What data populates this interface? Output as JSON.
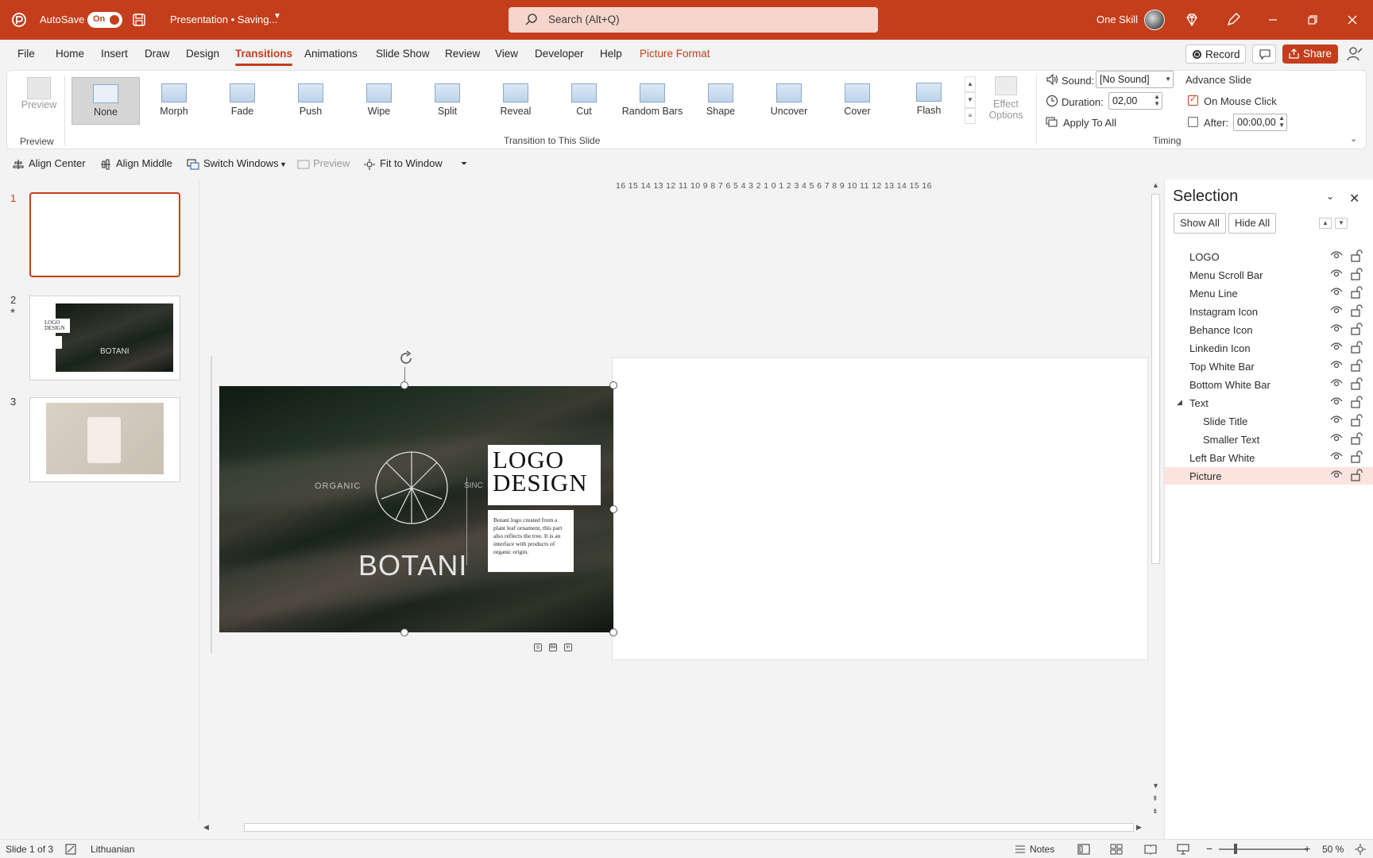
{
  "titlebar": {
    "autosave_label": "AutoSave",
    "autosave_state": "On",
    "doc_title": "Presentation • Saving...",
    "search_placeholder": "Search (Alt+Q)",
    "user_name": "One Skill",
    "accent_color": "#c43e1c"
  },
  "menu": {
    "tabs": [
      "File",
      "Home",
      "Insert",
      "Draw",
      "Design",
      "Transitions",
      "Animations",
      "Slide Show",
      "Review",
      "View",
      "Developer",
      "Help",
      "Picture Format"
    ],
    "active_tab": "Transitions",
    "record_label": "Record",
    "share_label": "Share"
  },
  "ribbon": {
    "preview_label": "Preview",
    "preview_group": "Preview",
    "transitions": [
      "None",
      "Morph",
      "Fade",
      "Push",
      "Wipe",
      "Split",
      "Reveal",
      "Cut",
      "Random Bars",
      "Shape",
      "Uncover",
      "Cover",
      "Flash"
    ],
    "selected_transition": "None",
    "effect_options_line1": "Effect",
    "effect_options_line2": "Options",
    "transition_group": "Transition to This Slide",
    "sound_label": "Sound:",
    "sound_value": "[No Sound]",
    "duration_label": "Duration:",
    "duration_value": "02,00",
    "apply_all_label": "Apply To All",
    "advance_title": "Advance Slide",
    "on_mouse_click_label": "On Mouse Click",
    "on_mouse_click_checked": true,
    "after_label": "After:",
    "after_checked": false,
    "after_value": "00:00,00",
    "timing_group": "Timing"
  },
  "qat": {
    "align_center": "Align Center",
    "align_middle": "Align Middle",
    "switch_windows": "Switch Windows",
    "preview": "Preview",
    "fit_to_window": "Fit to Window"
  },
  "slides": {
    "numbers": [
      "1",
      "2",
      "3"
    ],
    "active": "1",
    "thumb2_logo": "LOGO DESIGN",
    "thumb2_brand": "BOTANI"
  },
  "canvas": {
    "ruler_h": "16 15 14 13 12 11 10 9 8 7 6 5 4 3 2 1 0 1 2 3 4 5 6 7 8 9 10 11 12 13 14 15 16",
    "picture_organic": "ORGANIC",
    "picture_sinc": "SINC",
    "picture_brand": "BOTANI",
    "logo_line1": "LOGO",
    "logo_line2": "DESIGN",
    "description": "Botani logo created from a plant leaf ornament, this part also reflects the tree. It is an interface with products of organic origin."
  },
  "selection_pane": {
    "title": "Selection",
    "show_all": "Show All",
    "hide_all": "Hide All",
    "items": [
      {
        "name": "LOGO",
        "indent": 0
      },
      {
        "name": "Menu Scroll Bar",
        "indent": 0
      },
      {
        "name": "Menu Line",
        "indent": 0
      },
      {
        "name": "Instagram Icon",
        "indent": 0
      },
      {
        "name": "Behance Icon",
        "indent": 0
      },
      {
        "name": "Linkedin Icon",
        "indent": 0
      },
      {
        "name": "Top White Bar",
        "indent": 0
      },
      {
        "name": "Bottom White Bar",
        "indent": 0
      },
      {
        "name": "Text",
        "indent": 0
      },
      {
        "name": "Slide Title",
        "indent": 1
      },
      {
        "name": "Smaller Text",
        "indent": 1
      },
      {
        "name": "Left Bar White",
        "indent": 0
      },
      {
        "name": "Picture",
        "indent": 0
      }
    ],
    "selected_item": "Picture"
  },
  "statusbar": {
    "slide_info": "Slide 1 of 3",
    "language": "Lithuanian",
    "notes_label": "Notes",
    "zoom_level": "50 %"
  }
}
